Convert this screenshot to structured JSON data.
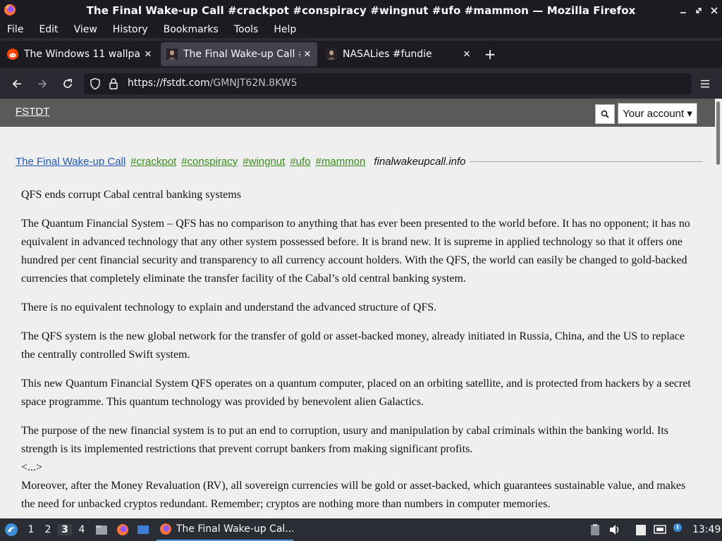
{
  "window": {
    "title": "The Final Wake-up Call #crackpot #conspiracy #wingnut #ufo #mammon — Mozilla Firefox",
    "controls": [
      "minimize-icon",
      "restore-icon",
      "close-icon"
    ]
  },
  "menubar": {
    "items": [
      "File",
      "Edit",
      "View",
      "History",
      "Bookmarks",
      "Tools",
      "Help"
    ]
  },
  "tabs": [
    {
      "label": "The Windows 11 wallpap",
      "favicon": "reddit-icon",
      "active": false
    },
    {
      "label": "The Final Wake-up Call #",
      "favicon": "fstdt-icon",
      "active": true
    },
    {
      "label": "NASALies #fundie",
      "favicon": "fstdt-icon",
      "active": false
    }
  ],
  "navbar": {
    "url_host": "https://fstdt.com",
    "url_path": "/GMNJT62N.8KW5"
  },
  "site": {
    "logo": "FSTDT",
    "account_label": "Your account ▾"
  },
  "post": {
    "title": "The Final Wake-up Call",
    "tags": [
      "#crackpot",
      "#conspiracy",
      "#wingnut",
      "#ufo",
      "#mammon"
    ],
    "source": "finalwakeupcall.info",
    "paragraphs": [
      "QFS ends corrupt Cabal central banking systems",
      "The Quantum Financial System – QFS has no comparison to anything that has ever been presented to the world before. It has no opponent; it has no equivalent in advanced technology that any other system possessed before. It is brand new. It is supreme in applied technology so that it offers one hundred per cent financial security and transparency to all currency account holders. With the QFS, the world can easily be changed to gold-backed currencies that completely eliminate the transfer facility of the Cabal’s old central banking system.",
      "There is no equivalent technology to explain and understand the advanced structure of QFS.",
      "The QFS system is the new global network for the transfer of gold or asset-backed money, already initiated in Russia, China, and the US to replace the centrally controlled Swift system.",
      "This new Quantum Financial System QFS operates on a quantum computer, placed on an orbiting satellite, and is protected from hackers by a secret space programme. This quantum technology was provided by benevolent alien Galactics.",
      "The purpose of the new financial system is to put an end to corruption, usury and manipulation by cabal criminals within the banking world. Its strength is its implemented restrictions that prevent corrupt bankers from making significant profits.",
      "<...>",
      "Moreover, after the Money Revaluation (RV), all sovereign currencies will be gold or asset-backed, which guarantees sustainable value, and makes the need for unbacked cryptos redundant. Remember; cryptos are nothing more than numbers in computer memories."
    ]
  },
  "taskbar": {
    "workspaces": [
      "1",
      "2",
      "3",
      "4"
    ],
    "current_workspace": "3",
    "task_label": "The Final Wake-up Cal...",
    "clock": "13:49"
  },
  "colors": {
    "chrome_dark": "#1c1b22",
    "toolbar": "#2b2a33",
    "active_tab": "#42414d",
    "site_header": "#5a5a5a",
    "page_bg": "#efefef",
    "link_blue": "#2257b0",
    "tag_green": "#3a8a1e"
  }
}
